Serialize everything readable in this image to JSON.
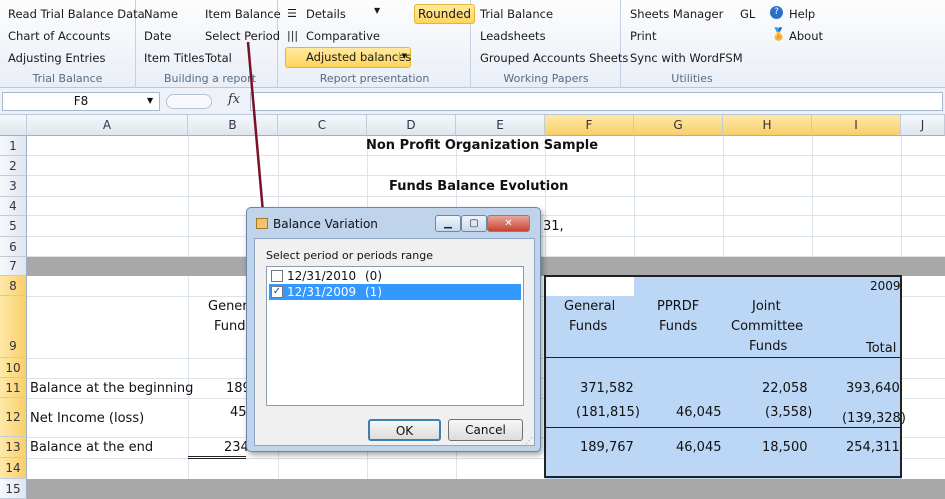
{
  "ribbon": {
    "trial_balance": {
      "items": [
        "Read Trial Balance Data",
        "Chart of Accounts",
        "Adjusting Entries"
      ],
      "label": "Trial Balance"
    },
    "building": {
      "col1": [
        "Name",
        "Date",
        "Item Titles"
      ],
      "col2": [
        "Item Balance",
        "Select Period",
        "Total"
      ],
      "label": "Building a report"
    },
    "presentation": {
      "details": "Details",
      "comparative": "Comparative",
      "adjusted": "Adjusted balances",
      "rounded": "Rounded",
      "label": "Report presentation"
    },
    "working": {
      "items": [
        "Trial Balance",
        "Leadsheets",
        "Grouped Accounts Sheets"
      ],
      "label": "Working Papers"
    },
    "utilities": {
      "items": [
        "Sheets Manager",
        "Print",
        "Sync with WordFSM"
      ],
      "gl": "GL",
      "help": "Help",
      "about": "About",
      "label": "Utilities"
    }
  },
  "formula": {
    "cell_ref": "F8",
    "fx": "fx"
  },
  "columns": [
    "A",
    "B",
    "C",
    "D",
    "E",
    "F",
    "G",
    "H",
    "I",
    "J"
  ],
  "rows": [
    "1",
    "2",
    "3",
    "4",
    "5",
    "6",
    "7",
    "8",
    "9",
    "10",
    "11",
    "12",
    "13",
    "14",
    "15"
  ],
  "sheet": {
    "title": "Non Profit Organization Sample",
    "subtitle": "Funds Balance Evolution",
    "row5_fragment": "31,",
    "year": "2009",
    "b_header": [
      "Gener",
      "Fund"
    ],
    "f_header": [
      "General",
      "Funds"
    ],
    "g_header": [
      "PPRDF",
      "Funds"
    ],
    "h_header": [
      "Joint",
      "Committee",
      "Funds"
    ],
    "i_header": "Total",
    "rows": [
      {
        "label": "Balance at the beginning",
        "b": "189",
        "f": "371,582",
        "g": "",
        "h": "22,058",
        "i": "393,640"
      },
      {
        "label": "Net Income (loss)",
        "b": "45",
        "f": "(181,815)",
        "g": "46,045",
        "h": "(3,558)",
        "i": "(139,328)"
      },
      {
        "label": "Balance at the end",
        "b": "234",
        "f": "189,767",
        "g": "46,045",
        "h": "18,500",
        "i": "254,311"
      }
    ]
  },
  "dialog": {
    "title": "Balance Variation",
    "prompt": "Select period or periods range",
    "items": [
      {
        "date": "12/31/2010",
        "count": "(0)",
        "checked": false
      },
      {
        "date": "12/31/2009",
        "count": "(1)",
        "checked": true
      }
    ],
    "ok": "OK",
    "cancel": "Cancel"
  },
  "colors": {
    "selection": "#bcd7f5",
    "list_selected": "#3399ff",
    "annotation": "#7b1028"
  }
}
